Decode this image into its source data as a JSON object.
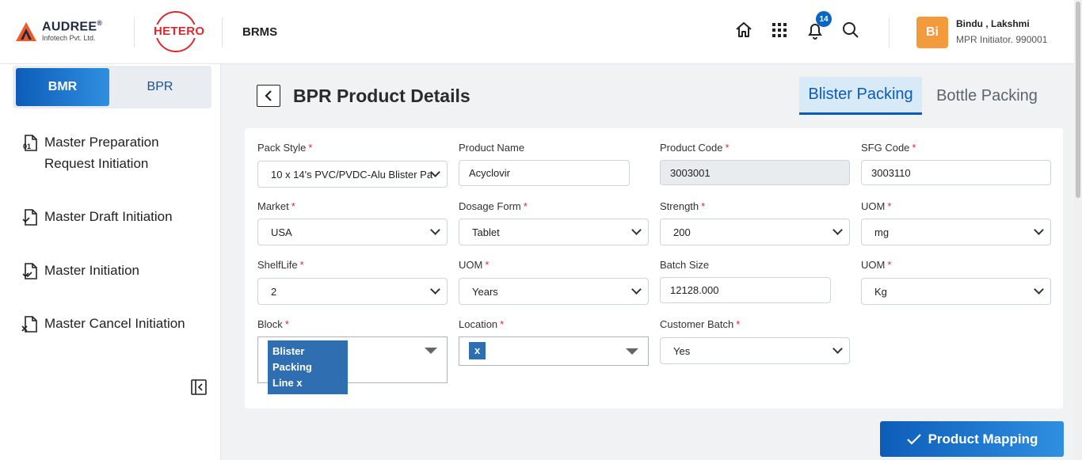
{
  "header": {
    "brand_name": "AUDREE",
    "brand_mark": "®",
    "brand_sub": "Infotech Pvt. Ltd.",
    "partner_logo": "HETERO",
    "app_name": "BRMS",
    "notification_count": "14",
    "user_initials": "Bi",
    "user_name": "Bindu , Lakshmi",
    "user_role": "MPR Initiator. 990001",
    "icons": [
      "home-icon",
      "apps-grid-icon",
      "bell-icon",
      "search-icon"
    ]
  },
  "sidebar": {
    "toggle": {
      "bmr": "BMR",
      "bpr": "BPR",
      "active": "BMR"
    },
    "items": [
      {
        "label_line1": "Master Preparation",
        "label_line2": "Request Initiation",
        "icon": "document-01-icon"
      },
      {
        "label": "Master Draft Initiation",
        "icon": "document-check-icon"
      },
      {
        "label": "Master Initiation",
        "icon": "document-double-check-icon"
      },
      {
        "label": "Master Cancel Initiation",
        "icon": "document-cancel-icon"
      }
    ]
  },
  "main": {
    "title": "BPR Product Details",
    "tabs": [
      {
        "label": "Blister Packing",
        "active": true
      },
      {
        "label": "Bottle Packing",
        "active": false
      }
    ],
    "required_mark": "*",
    "form": {
      "pack_style": {
        "label": "Pack Style",
        "value": "10 x 14's PVC/PVDC-Alu Blister Pa"
      },
      "product_name": {
        "label": "Product Name",
        "value": "Acyclovir"
      },
      "product_code": {
        "label": "Product Code",
        "value": "3003001"
      },
      "sfg_code": {
        "label": "SFG Code",
        "value": "3003110"
      },
      "market": {
        "label": "Market",
        "value": "USA"
      },
      "dosage_form": {
        "label": "Dosage Form",
        "value": "Tablet"
      },
      "strength": {
        "label": "Strength",
        "value": "200"
      },
      "uom1": {
        "label": "UOM",
        "value": "mg"
      },
      "shelf_life": {
        "label": "ShelfLife",
        "value": "2"
      },
      "uom2": {
        "label": "UOM",
        "value": "Years"
      },
      "batch_size": {
        "label": "Batch Size",
        "value": "12128.000"
      },
      "uom3": {
        "label": "UOM",
        "value": "Kg"
      },
      "block": {
        "label": "Block",
        "chip_line1": "Blister Packing",
        "chip_line2": "Line x"
      },
      "location": {
        "label": "Location",
        "chip": "x"
      },
      "customer_batch": {
        "label": "Customer Batch",
        "value": "Yes"
      }
    },
    "primary_button": "Product Mapping"
  }
}
